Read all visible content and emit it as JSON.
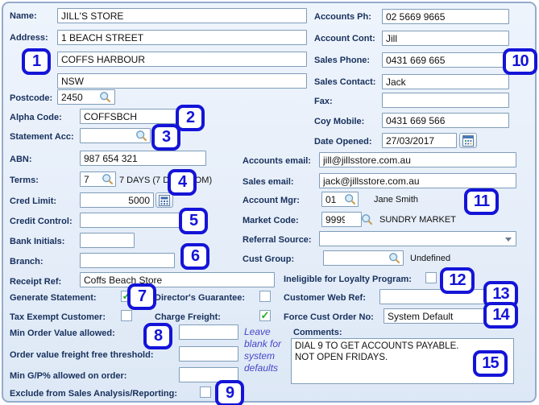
{
  "left": {
    "name": {
      "label": "Name:",
      "value": "JILL'S STORE"
    },
    "address": {
      "label": "Address:",
      "line1": "1 BEACH STREET",
      "line2": "COFFS HARBOUR",
      "line3": "NSW"
    },
    "postcode": {
      "label": "Postcode:",
      "value": "2450"
    },
    "alpha_code": {
      "label": "Alpha Code:",
      "value": "COFFSBCH"
    },
    "statement_acc": {
      "label": "Statement Acc:",
      "value": ""
    },
    "abn": {
      "label": "ABN:",
      "value": "987 654 321"
    },
    "terms": {
      "label": "Terms:",
      "value": "7",
      "description": "7 DAYS (7 DAYS EOM)"
    },
    "cred_limit": {
      "label": "Cred Limit:",
      "value": "5000"
    },
    "credit_control": {
      "label": "Credit Control:",
      "value": ""
    },
    "bank_initials": {
      "label": "Bank Initials:",
      "value": ""
    },
    "branch": {
      "label": "Branch:",
      "value": ""
    },
    "receipt_ref": {
      "label": "Receipt Ref:",
      "value": "Coffs Beach Store"
    },
    "generate_statement": {
      "label": "Generate Statement:",
      "checked": true
    },
    "directors_guarantee": {
      "label": "Director's Guarantee:",
      "checked": false
    },
    "tax_exempt": {
      "label": "Tax Exempt Customer:",
      "checked": false
    },
    "charge_freight": {
      "label": "Charge Freight:",
      "checked": true
    },
    "min_order_value": {
      "label": "Min Order Value allowed:",
      "value": ""
    },
    "freight_free_threshold": {
      "label": "Order value freight free threshold:",
      "value": ""
    },
    "min_gp": {
      "label": "Min G/P% allowed on order:",
      "value": ""
    },
    "exclude_sales": {
      "label": "Exclude from Sales Analysis/Reporting:",
      "checked": false
    },
    "defaults_note": "Leave blank for system defaults"
  },
  "right": {
    "accounts_ph": {
      "label": "Accounts Ph:",
      "value": "02 5669 9665"
    },
    "account_cont": {
      "label": "Account Cont:",
      "value": "Jill"
    },
    "sales_phone": {
      "label": "Sales Phone:",
      "value": "0431 669 665"
    },
    "sales_contact": {
      "label": "Sales Contact:",
      "value": "Jack"
    },
    "fax": {
      "label": "Fax:",
      "value": ""
    },
    "coy_mobile": {
      "label": "Coy Mobile:",
      "value": "0431 669 566"
    },
    "date_opened": {
      "label": "Date Opened:",
      "value": "27/03/2017"
    },
    "accounts_email": {
      "label": "Accounts email:",
      "value": "jill@jillsstore.com.au"
    },
    "sales_email": {
      "label": "Sales email:",
      "value": "jack@jillsstore.com.au"
    },
    "account_mgr": {
      "label": "Account Mgr:",
      "value": "01",
      "description": "Jane Smith"
    },
    "market_code": {
      "label": "Market Code:",
      "value": "9999",
      "description": "SUNDRY MARKET"
    },
    "referral_source": {
      "label": "Referral Source:",
      "value": ""
    },
    "cust_group": {
      "label": "Cust Group:",
      "value": "",
      "description": "Undefined"
    },
    "ineligible_loyalty": {
      "label": "Ineligible for Loyalty Program:",
      "checked": false
    },
    "customer_web_ref": {
      "label": "Customer Web Ref:",
      "value": ""
    },
    "force_cust_order_no": {
      "label": "Force Cust Order No:",
      "value": "System Default"
    },
    "comments": {
      "label": "Comments:",
      "value": "DIAL 9 TO GET ACCOUNTS PAYABLE.\nNOT OPEN FRIDAYS."
    }
  },
  "callouts": {
    "c1": "1",
    "c2": "2",
    "c3": "3",
    "c4": "4",
    "c5": "5",
    "c6": "6",
    "c7": "7",
    "c8": "8",
    "c9": "9",
    "c10": "10",
    "c11": "11",
    "c12": "12",
    "c13": "13",
    "c14": "14",
    "c15": "15"
  },
  "colors": {
    "callout_blue": "#1414d8",
    "label_navy": "#17305c",
    "note_blue": "#4646c8",
    "check_green": "#22ad22",
    "panel_bg": "#e6eef9",
    "input_border": "#7f9db9"
  }
}
